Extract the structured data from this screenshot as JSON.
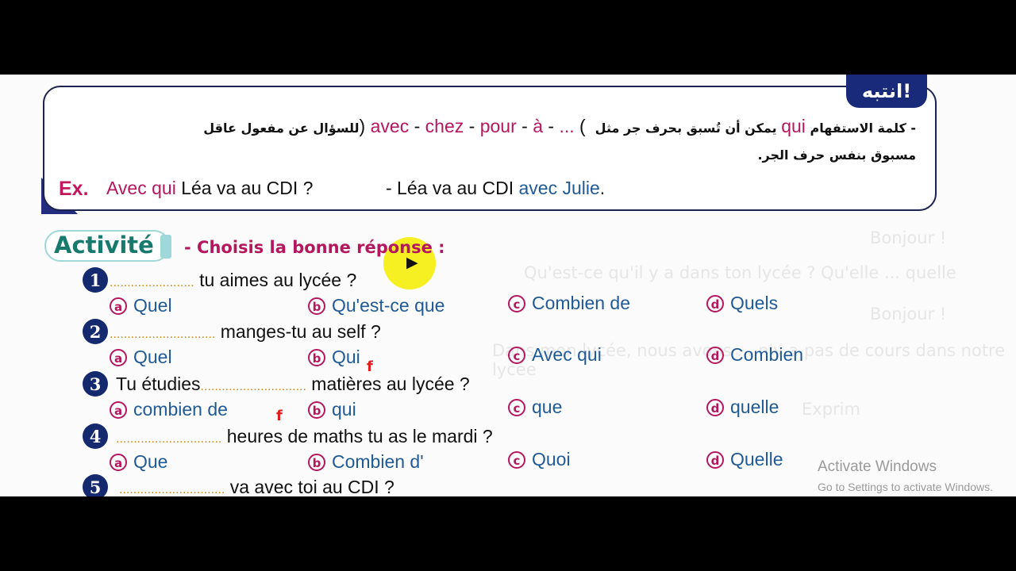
{
  "note": {
    "badge": "انتبه!",
    "line1_a": "- كلمة الاستفهام",
    "line1_qui": "qui",
    "line1_b": "يمكن أن تُسبق بحرف جر مثل",
    "line1_paren_open": "(",
    "line1_p1": "avec",
    "line1_p2": "chez",
    "line1_p3": "pour",
    "line1_p4": "à",
    "line1_p5": "...",
    "line1_sep": "-",
    "line1_paren_close": ")",
    "line1_c": "للسؤال عن مفعول عاقل",
    "line2": "مسبوق بنفس حرف الجر.",
    "ex_label": "Ex.",
    "ex1_colored": "Avec qui",
    "ex1_rest": "Léa va au CDI ?",
    "ex2_plain": "- Léa va au CDI",
    "ex2_colored": "avec Julie",
    "ex2_end": "."
  },
  "activity": {
    "label": "Activité",
    "instruction": "- Choisis la bonne réponse :"
  },
  "questions": [
    {
      "num": "1",
      "before": "",
      "dots": "........................",
      "after": "tu aimes au lycée ?",
      "options": [
        {
          "letter": "a",
          "text": "Quel"
        },
        {
          "letter": "b",
          "text": "Qu'est-ce que"
        },
        {
          "letter": "c",
          "text": "Combien de"
        },
        {
          "letter": "d",
          "text": "Quels"
        }
      ]
    },
    {
      "num": "2",
      "before": "",
      "dots": "..............................",
      "after": "manges-tu au self ?",
      "options": [
        {
          "letter": "a",
          "text": "Quel"
        },
        {
          "letter": "b",
          "text": "Qui"
        },
        {
          "letter": "c",
          "text": "Avec qui"
        },
        {
          "letter": "d",
          "text": "Combien"
        }
      ]
    },
    {
      "num": "3",
      "before": "Tu étudies",
      "dots": "..............................",
      "after": "matières au lycée ?",
      "options": [
        {
          "letter": "a",
          "text": "combien de"
        },
        {
          "letter": "b",
          "text": "qui"
        },
        {
          "letter": "c",
          "text": "que"
        },
        {
          "letter": "d",
          "text": "quelle"
        }
      ]
    },
    {
      "num": "4",
      "before": "",
      "dots": "..............................",
      "after": "heures de maths tu as le mardi ?",
      "options": [
        {
          "letter": "a",
          "text": "Que"
        },
        {
          "letter": "b",
          "text": "Combien d'"
        },
        {
          "letter": "c",
          "text": "Quoi"
        },
        {
          "letter": "d",
          "text": "Quelle"
        }
      ]
    },
    {
      "num": "5",
      "before": "",
      "dots": "..............................",
      "after": "va avec toi au CDI ?",
      "options": []
    }
  ],
  "annotations": {
    "mark1": "f",
    "mark2": "f"
  },
  "watermark": {
    "w1": "Bonjour !",
    "w2": "Qu'est-ce qu'il y a dans ton lycée ? Qu'elle ... quelle",
    "w3": "Bonjour !",
    "w4": "Dans mon lycée, nous avons ... n'y a pas de cours dans notre lycée",
    "w5": "Exprim"
  },
  "windows": {
    "title": "Activate Windows",
    "subtitle": "Go to Settings to activate Windows."
  }
}
